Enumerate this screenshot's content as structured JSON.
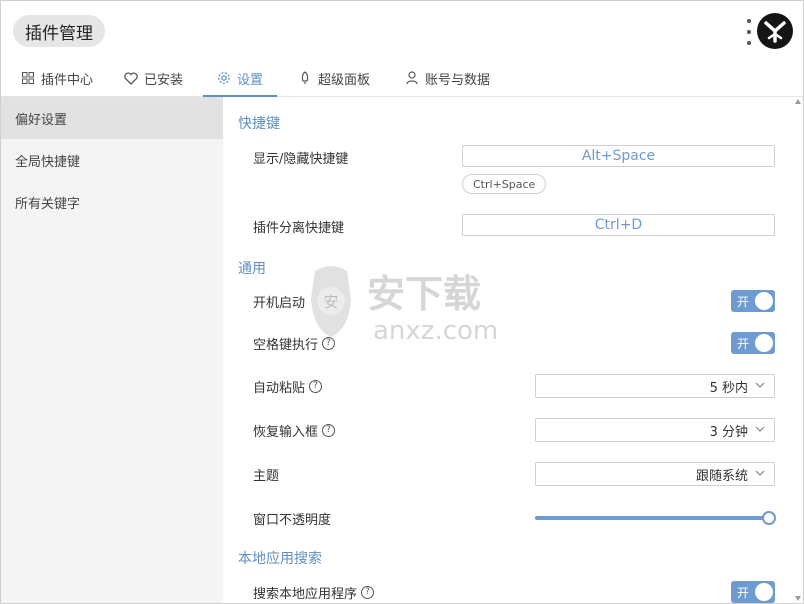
{
  "header": {
    "title": "插件管理"
  },
  "tabs": [
    {
      "label": "插件中心",
      "icon": "grid-icon"
    },
    {
      "label": "已安装",
      "icon": "heart-icon"
    },
    {
      "label": "设置",
      "icon": "gear-icon"
    },
    {
      "label": "超级面板",
      "icon": "rocket-icon"
    },
    {
      "label": "账号与数据",
      "icon": "user-icon"
    }
  ],
  "active_tab": "设置",
  "sidebar": {
    "items": [
      {
        "label": "偏好设置"
      },
      {
        "label": "全局快捷键"
      },
      {
        "label": "所有关键字"
      }
    ]
  },
  "shortcuts": {
    "section_title": "快捷键",
    "show_hide_label": "显示/隐藏快捷键",
    "show_hide_value": "Alt+Space",
    "show_hide_chip": "Ctrl+Space",
    "detach_label": "插件分离快捷键",
    "detach_value": "Ctrl+D"
  },
  "general": {
    "section_title": "通用",
    "startup_label": "开机启动",
    "startup_toggle": "开",
    "space_exec_label": "空格键执行",
    "space_exec_toggle": "开",
    "auto_paste_label": "自动粘贴",
    "auto_paste_value": "5 秒内",
    "restore_input_label": "恢复输入框",
    "restore_input_value": "3 分钟",
    "theme_label": "主题",
    "theme_value": "跟随系统",
    "opacity_label": "窗口不透明度",
    "opacity_level": 1.0
  },
  "local_search": {
    "section_title": "本地应用搜索",
    "search_apps_label": "搜索本地应用程序",
    "search_apps_toggle": "开"
  },
  "watermark": {
    "text": "安下载",
    "domain": "anxz.com"
  },
  "colors": {
    "accent": "#6e9bd0",
    "sidebar_bg": "#f4f4f4",
    "sidebar_active": "#e2e2e2"
  }
}
